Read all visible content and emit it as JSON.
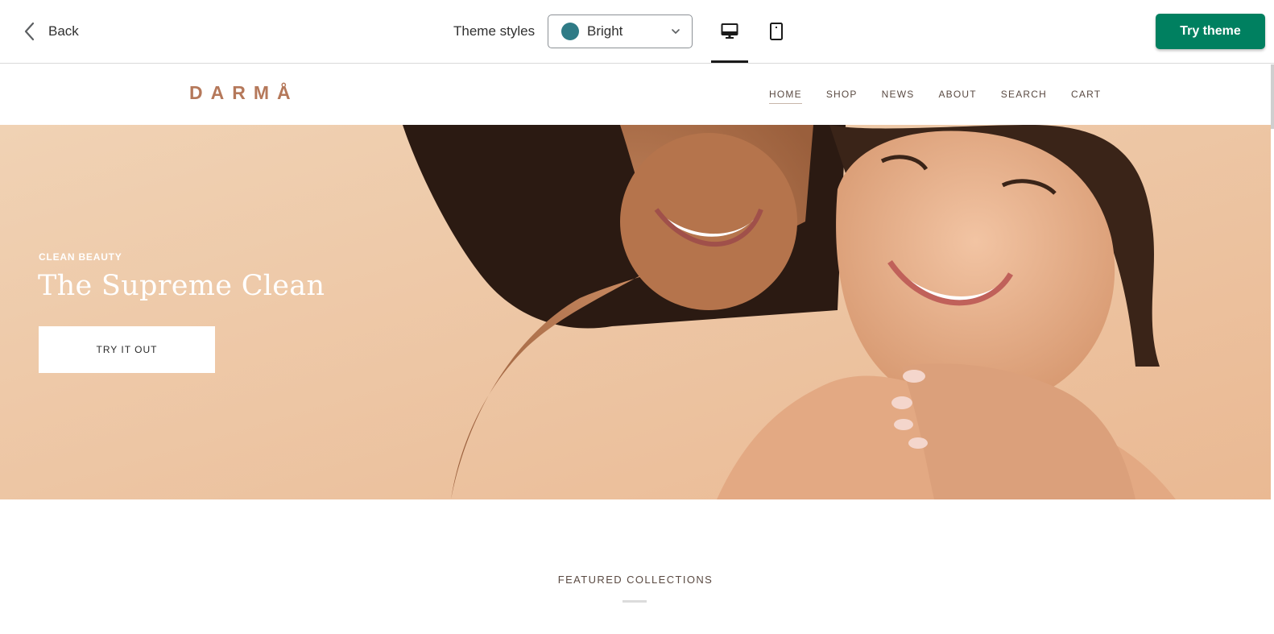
{
  "editor": {
    "back_label": "Back",
    "theme_styles_label": "Theme styles",
    "theme_style_value": "Bright",
    "theme_swatch_color": "#2f7b86",
    "device_desktop_icon": "desktop-icon",
    "device_mobile_icon": "mobile-icon",
    "active_device": "desktop",
    "try_theme_label": "Try theme",
    "accent_color": "#008060"
  },
  "store": {
    "logo": "DARMÅ",
    "nav": [
      {
        "label": "HOME",
        "active": true
      },
      {
        "label": "SHOP",
        "active": false
      },
      {
        "label": "NEWS",
        "active": false
      },
      {
        "label": "ABOUT",
        "active": false
      },
      {
        "label": "SEARCH",
        "active": false
      },
      {
        "label": "CART",
        "active": false
      }
    ],
    "hero": {
      "eyebrow": "CLEAN BEAUTY",
      "title": "The Supreme Clean",
      "button_label": "TRY IT OUT"
    },
    "featured_heading": "FEATURED COLLECTIONS"
  }
}
